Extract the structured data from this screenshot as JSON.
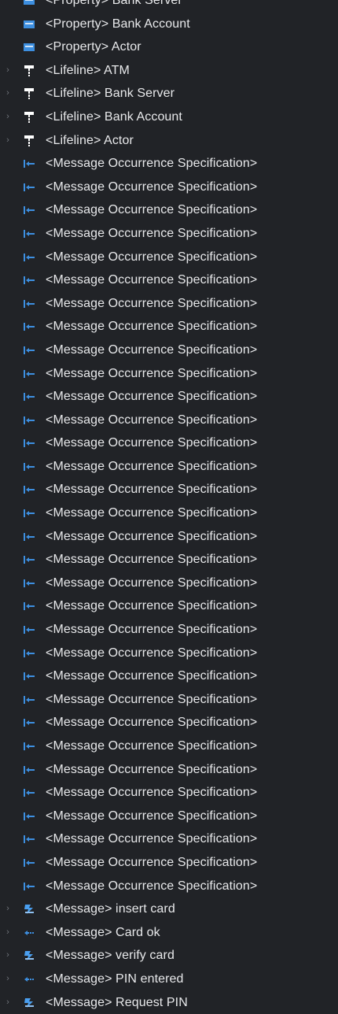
{
  "colors": {
    "background": "#212327",
    "text": "#e8e9eb",
    "twisty": "#6f737a",
    "property_icon": "#3d8fe0",
    "lifeline_icon": "#ffffff",
    "mos_icon": "#3d8fe0",
    "message_icon_blue": "#4a9ff0"
  },
  "tree": {
    "items": [
      {
        "type": "property",
        "label": "<Property> Bank Server",
        "expandable": false
      },
      {
        "type": "property",
        "label": "<Property> Bank Account",
        "expandable": false
      },
      {
        "type": "property",
        "label": "<Property> Actor",
        "expandable": false
      },
      {
        "type": "lifeline",
        "label": "<Lifeline> ATM",
        "expandable": true
      },
      {
        "type": "lifeline",
        "label": "<Lifeline> Bank Server",
        "expandable": true
      },
      {
        "type": "lifeline",
        "label": "<Lifeline> Bank Account",
        "expandable": true
      },
      {
        "type": "lifeline",
        "label": "<Lifeline> Actor",
        "expandable": true
      },
      {
        "type": "mos",
        "label": "<Message Occurrence Specification>",
        "expandable": false
      },
      {
        "type": "mos",
        "label": "<Message Occurrence Specification>",
        "expandable": false
      },
      {
        "type": "mos",
        "label": "<Message Occurrence Specification>",
        "expandable": false
      },
      {
        "type": "mos",
        "label": "<Message Occurrence Specification>",
        "expandable": false
      },
      {
        "type": "mos",
        "label": "<Message Occurrence Specification>",
        "expandable": false
      },
      {
        "type": "mos",
        "label": "<Message Occurrence Specification>",
        "expandable": false
      },
      {
        "type": "mos",
        "label": "<Message Occurrence Specification>",
        "expandable": false
      },
      {
        "type": "mos",
        "label": "<Message Occurrence Specification>",
        "expandable": false
      },
      {
        "type": "mos",
        "label": "<Message Occurrence Specification>",
        "expandable": false
      },
      {
        "type": "mos",
        "label": "<Message Occurrence Specification>",
        "expandable": false
      },
      {
        "type": "mos",
        "label": "<Message Occurrence Specification>",
        "expandable": false
      },
      {
        "type": "mos",
        "label": "<Message Occurrence Specification>",
        "expandable": false
      },
      {
        "type": "mos",
        "label": "<Message Occurrence Specification>",
        "expandable": false
      },
      {
        "type": "mos",
        "label": "<Message Occurrence Specification>",
        "expandable": false
      },
      {
        "type": "mos",
        "label": "<Message Occurrence Specification>",
        "expandable": false
      },
      {
        "type": "mos",
        "label": "<Message Occurrence Specification>",
        "expandable": false
      },
      {
        "type": "mos",
        "label": "<Message Occurrence Specification>",
        "expandable": false
      },
      {
        "type": "mos",
        "label": "<Message Occurrence Specification>",
        "expandable": false
      },
      {
        "type": "mos",
        "label": "<Message Occurrence Specification>",
        "expandable": false
      },
      {
        "type": "mos",
        "label": "<Message Occurrence Specification>",
        "expandable": false
      },
      {
        "type": "mos",
        "label": "<Message Occurrence Specification>",
        "expandable": false
      },
      {
        "type": "mos",
        "label": "<Message Occurrence Specification>",
        "expandable": false
      },
      {
        "type": "mos",
        "label": "<Message Occurrence Specification>",
        "expandable": false
      },
      {
        "type": "mos",
        "label": "<Message Occurrence Specification>",
        "expandable": false
      },
      {
        "type": "mos",
        "label": "<Message Occurrence Specification>",
        "expandable": false
      },
      {
        "type": "mos",
        "label": "<Message Occurrence Specification>",
        "expandable": false
      },
      {
        "type": "mos",
        "label": "<Message Occurrence Specification>",
        "expandable": false
      },
      {
        "type": "mos",
        "label": "<Message Occurrence Specification>",
        "expandable": false
      },
      {
        "type": "mos",
        "label": "<Message Occurrence Specification>",
        "expandable": false
      },
      {
        "type": "mos",
        "label": "<Message Occurrence Specification>",
        "expandable": false
      },
      {
        "type": "mos",
        "label": "<Message Occurrence Specification>",
        "expandable": false
      },
      {
        "type": "mos",
        "label": "<Message Occurrence Specification>",
        "expandable": false
      },
      {
        "type": "message-sync",
        "label": "<Message> insert card",
        "expandable": true
      },
      {
        "type": "message-reply",
        "label": "<Message> Card ok",
        "expandable": true
      },
      {
        "type": "message-sync",
        "label": "<Message> verify card",
        "expandable": true
      },
      {
        "type": "message-reply",
        "label": "<Message> PIN entered",
        "expandable": true
      },
      {
        "type": "message-sync",
        "label": "<Message> Request PIN",
        "expandable": true
      }
    ]
  },
  "icons": {
    "property": "property-icon",
    "lifeline": "lifeline-icon",
    "mos": "message-occurrence-icon",
    "message-sync": "message-icon",
    "message-reply": "reply-message-icon",
    "twisty": "chevron-right-icon"
  }
}
